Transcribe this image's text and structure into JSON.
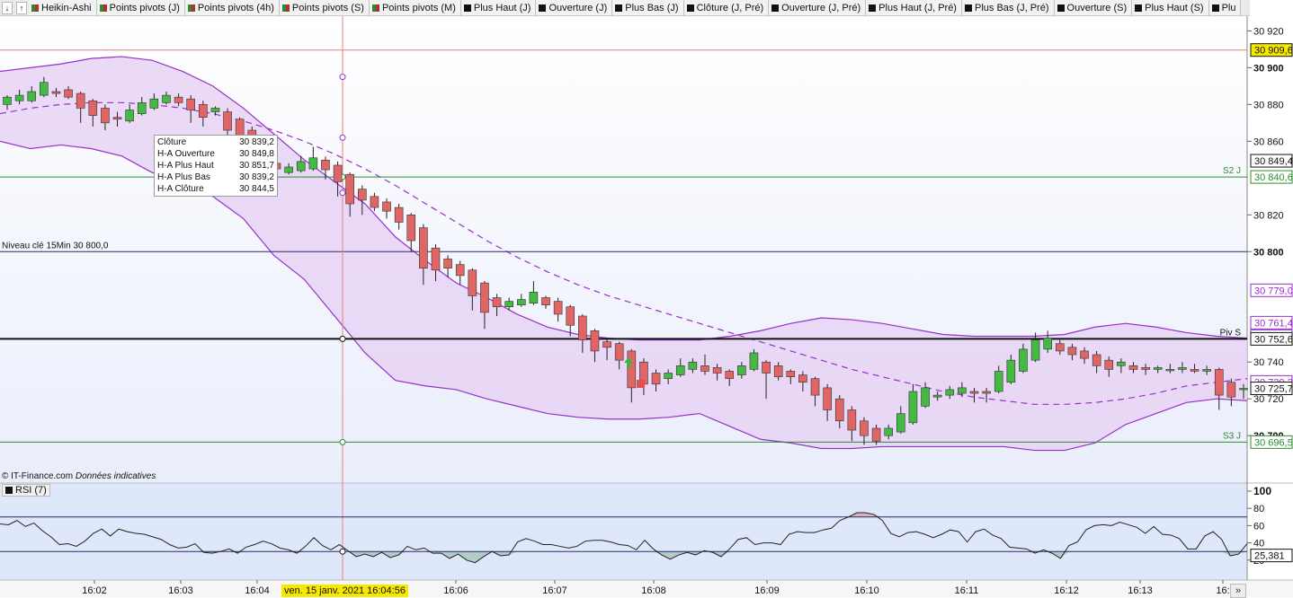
{
  "toolbar": {
    "items": [
      {
        "label": "Heikin-Ashi",
        "marker": "grn"
      },
      {
        "label": "Points pivots (J)",
        "marker": "grn"
      },
      {
        "label": "Points pivots (4h)",
        "marker": "grn"
      },
      {
        "label": "Points pivots (S)",
        "marker": "grn"
      },
      {
        "label": "Points pivots (M)",
        "marker": "grn"
      },
      {
        "label": "Plus Haut (J)",
        "marker": "blk"
      },
      {
        "label": "Ouverture (J)",
        "marker": "blk"
      },
      {
        "label": "Plus Bas (J)",
        "marker": "blk"
      },
      {
        "label": "Clôture (J, Pré)",
        "marker": "blk"
      },
      {
        "label": "Ouverture (J, Pré)",
        "marker": "blk"
      },
      {
        "label": "Plus Haut (J, Pré)",
        "marker": "blk"
      },
      {
        "label": "Plus Bas (J, Pré)",
        "marker": "blk"
      },
      {
        "label": "Ouverture (S)",
        "marker": "blk"
      },
      {
        "label": "Plus Haut (S)",
        "marker": "blk"
      },
      {
        "label": "Plu",
        "marker": "blk"
      }
    ]
  },
  "tooltip": {
    "rows": [
      {
        "label": "Clôture",
        "value": "30 839,2"
      },
      {
        "label": "H-A Ouverture",
        "value": "30 849,8"
      },
      {
        "label": "H-A Plus Haut",
        "value": "30 851,7"
      },
      {
        "label": "H-A Plus Bas",
        "value": "30 839,2"
      },
      {
        "label": "H-A Clôture",
        "value": "30 844,5"
      }
    ]
  },
  "credit": {
    "source": "© IT-Finance.com",
    "note": "Données indicatives"
  },
  "rsi_label": "RSI (7)",
  "crosshair_date": "ven. 15 janv. 2021 16:04:56",
  "scroll_glyph": "»",
  "colors": {
    "up": "#44b944",
    "down": "#e06666",
    "band": "#9a2fc9",
    "band_fill": "#e6d3f4",
    "support": "#2e8b2e",
    "pivot": "#111111",
    "key": "#2a2a6a",
    "cursor": "#e88080",
    "rsi": "#222266"
  },
  "chart_data": {
    "type": "candlestick",
    "ylim": [
      30683,
      30928
    ],
    "yticks": [
      {
        "v": 30920,
        "t": "30 920"
      },
      {
        "v": 30900,
        "t": "30 900"
      },
      {
        "v": 30880,
        "t": "30 880"
      },
      {
        "v": 30860,
        "t": "30 860"
      },
      {
        "v": 30820,
        "t": "30 820"
      },
      {
        "v": 30800,
        "t": "30 800"
      },
      {
        "v": 30740,
        "t": "30 740"
      },
      {
        "v": 30720,
        "t": "30 720"
      },
      {
        "v": 30700,
        "t": "30 700"
      }
    ],
    "xticks": [
      "16:02",
      "16:03",
      "16:04",
      "16:06",
      "16:07",
      "16:08",
      "16:09",
      "16:10",
      "16:11",
      "16:12",
      "16:13",
      "16:"
    ],
    "hlines": [
      {
        "name": "cursor-price",
        "v": 30909.6,
        "label": "",
        "tag": "30 909,6",
        "tagbg": "#f7e800",
        "color": "cursor"
      },
      {
        "name": "s2-j",
        "v": 30840.6,
        "label": "S2 J",
        "tag": "30 840,6",
        "tagbg": "#fff",
        "color": "support"
      },
      {
        "name": "key-level",
        "v": 30800,
        "label": "Niveau clé 15Min 30 800,0",
        "tag": "",
        "tagbg": "#fff",
        "color": "key"
      },
      {
        "name": "piv-s",
        "v": 30752.6,
        "label": "Piv S",
        "tag": "30 752,6",
        "tagbg": "#fff",
        "color": "pivot"
      },
      {
        "name": "s3-j",
        "v": 30696.5,
        "label": "S3 J",
        "tag": "30 696,5",
        "tagbg": "#fff",
        "color": "support"
      }
    ],
    "price_tags": [
      {
        "v": 30849.4,
        "t": "30 849,4",
        "color": "#111"
      },
      {
        "v": 30779.0,
        "t": "30 779,0",
        "color": "#9a2fc9"
      },
      {
        "v": 30761.4,
        "t": "30 761,4",
        "color": "#9a2fc9"
      },
      {
        "v": 30754.1,
        "t": "30 754,1",
        "color": "#9a2fc9"
      },
      {
        "v": 30729.2,
        "t": "30 729,2",
        "color": "#9a2fc9"
      },
      {
        "v": 30725.7,
        "t": "30 725,7",
        "color": "#111"
      }
    ],
    "candles": [
      {
        "o": 30880,
        "h": 30885,
        "l": 30877,
        "c": 30884
      },
      {
        "o": 30882,
        "h": 30888,
        "l": 30880,
        "c": 30885
      },
      {
        "o": 30882,
        "h": 30890,
        "l": 30881,
        "c": 30887
      },
      {
        "o": 30885,
        "h": 30895,
        "l": 30884,
        "c": 30892
      },
      {
        "o": 30887,
        "h": 30889,
        "l": 30884,
        "c": 30886
      },
      {
        "o": 30888,
        "h": 30890,
        "l": 30883,
        "c": 30884
      },
      {
        "o": 30886,
        "h": 30887,
        "l": 30870,
        "c": 30878
      },
      {
        "o": 30882,
        "h": 30883,
        "l": 30868,
        "c": 30874
      },
      {
        "o": 30878,
        "h": 30880,
        "l": 30866,
        "c": 30870
      },
      {
        "o": 30873,
        "h": 30876,
        "l": 30868,
        "c": 30872
      },
      {
        "o": 30871,
        "h": 30880,
        "l": 30870,
        "c": 30877
      },
      {
        "o": 30875,
        "h": 30884,
        "l": 30874,
        "c": 30881
      },
      {
        "o": 30878,
        "h": 30886,
        "l": 30877,
        "c": 30883
      },
      {
        "o": 30881,
        "h": 30887,
        "l": 30880,
        "c": 30885
      },
      {
        "o": 30884,
        "h": 30886,
        "l": 30879,
        "c": 30881
      },
      {
        "o": 30883,
        "h": 30885,
        "l": 30870,
        "c": 30877
      },
      {
        "o": 30880,
        "h": 30882,
        "l": 30868,
        "c": 30873
      },
      {
        "o": 30876,
        "h": 30879,
        "l": 30874,
        "c": 30878
      },
      {
        "o": 30876,
        "h": 30878,
        "l": 30860,
        "c": 30866
      },
      {
        "o": 30872,
        "h": 30873,
        "l": 30848,
        "c": 30860
      },
      {
        "o": 30866,
        "h": 30868,
        "l": 30845,
        "c": 30852
      },
      {
        "o": 30856,
        "h": 30858,
        "l": 30838,
        "c": 30844
      },
      {
        "o": 30848,
        "h": 30850,
        "l": 30842,
        "c": 30845
      },
      {
        "o": 30843,
        "h": 30848,
        "l": 30842,
        "c": 30846
      },
      {
        "o": 30844,
        "h": 30852,
        "l": 30843,
        "c": 30849
      },
      {
        "o": 30845,
        "h": 30857,
        "l": 30844,
        "c": 30851
      },
      {
        "o": 30849.8,
        "h": 30851.7,
        "l": 30839.2,
        "c": 30844.5
      },
      {
        "o": 30847,
        "h": 30849,
        "l": 30830,
        "c": 30838
      },
      {
        "o": 30842,
        "h": 30843,
        "l": 30819,
        "c": 30826
      },
      {
        "o": 30834,
        "h": 30836,
        "l": 30820,
        "c": 30828
      },
      {
        "o": 30830,
        "h": 30832,
        "l": 30822,
        "c": 30824
      },
      {
        "o": 30827,
        "h": 30829,
        "l": 30818,
        "c": 30822
      },
      {
        "o": 30824,
        "h": 30826,
        "l": 30812,
        "c": 30816
      },
      {
        "o": 30820,
        "h": 30821,
        "l": 30800,
        "c": 30806
      },
      {
        "o": 30813,
        "h": 30815,
        "l": 30782,
        "c": 30791
      },
      {
        "o": 30802,
        "h": 30804,
        "l": 30784,
        "c": 30790
      },
      {
        "o": 30796,
        "h": 30798,
        "l": 30786,
        "c": 30791
      },
      {
        "o": 30793,
        "h": 30795,
        "l": 30782,
        "c": 30787
      },
      {
        "o": 30790,
        "h": 30791,
        "l": 30768,
        "c": 30776
      },
      {
        "o": 30783,
        "h": 30784,
        "l": 30758,
        "c": 30767
      },
      {
        "o": 30775,
        "h": 30777,
        "l": 30765,
        "c": 30770
      },
      {
        "o": 30770,
        "h": 30775,
        "l": 30768,
        "c": 30773
      },
      {
        "o": 30771,
        "h": 30777,
        "l": 30770,
        "c": 30774
      },
      {
        "o": 30772,
        "h": 30784,
        "l": 30771,
        "c": 30778
      },
      {
        "o": 30775,
        "h": 30776,
        "l": 30769,
        "c": 30771
      },
      {
        "o": 30773,
        "h": 30775,
        "l": 30762,
        "c": 30766
      },
      {
        "o": 30770,
        "h": 30771,
        "l": 30754,
        "c": 30760
      },
      {
        "o": 30765,
        "h": 30766,
        "l": 30745,
        "c": 30752
      },
      {
        "o": 30757,
        "h": 30758,
        "l": 30740,
        "c": 30746
      },
      {
        "o": 30751,
        "h": 30753,
        "l": 30741,
        "c": 30748
      },
      {
        "o": 30750,
        "h": 30751,
        "l": 30736,
        "c": 30741
      },
      {
        "o": 30746,
        "h": 30747,
        "l": 30718,
        "c": 30726
      },
      {
        "o": 30740,
        "h": 30742,
        "l": 30722,
        "c": 30728
      },
      {
        "o": 30734,
        "h": 30736,
        "l": 30724,
        "c": 30728
      },
      {
        "o": 30731,
        "h": 30736,
        "l": 30728,
        "c": 30734
      },
      {
        "o": 30733,
        "h": 30742,
        "l": 30732,
        "c": 30738
      },
      {
        "o": 30736,
        "h": 30742,
        "l": 30734,
        "c": 30740
      },
      {
        "o": 30738,
        "h": 30744,
        "l": 30733,
        "c": 30735
      },
      {
        "o": 30737,
        "h": 30739,
        "l": 30730,
        "c": 30734
      },
      {
        "o": 30735,
        "h": 30736,
        "l": 30727,
        "c": 30731
      },
      {
        "o": 30733,
        "h": 30740,
        "l": 30731,
        "c": 30738
      },
      {
        "o": 30736,
        "h": 30747,
        "l": 30735,
        "c": 30745
      },
      {
        "o": 30740,
        "h": 30741,
        "l": 30720,
        "c": 30734
      },
      {
        "o": 30738,
        "h": 30740,
        "l": 30730,
        "c": 30732
      },
      {
        "o": 30735,
        "h": 30736,
        "l": 30728,
        "c": 30732
      },
      {
        "o": 30733,
        "h": 30735,
        "l": 30724,
        "c": 30729
      },
      {
        "o": 30731,
        "h": 30732,
        "l": 30716,
        "c": 30722
      },
      {
        "o": 30726,
        "h": 30728,
        "l": 30708,
        "c": 30714
      },
      {
        "o": 30720,
        "h": 30722,
        "l": 30704,
        "c": 30708
      },
      {
        "o": 30714,
        "h": 30716,
        "l": 30697,
        "c": 30703
      },
      {
        "o": 30708,
        "h": 30710,
        "l": 30695,
        "c": 30700
      },
      {
        "o": 30704,
        "h": 30706,
        "l": 30695,
        "c": 30697
      },
      {
        "o": 30700,
        "h": 30706,
        "l": 30698,
        "c": 30704
      },
      {
        "o": 30702,
        "h": 30716,
        "l": 30701,
        "c": 30712
      },
      {
        "o": 30707,
        "h": 30728,
        "l": 30706,
        "c": 30724
      },
      {
        "o": 30716,
        "h": 30729,
        "l": 30715,
        "c": 30726
      },
      {
        "o": 30721,
        "h": 30724,
        "l": 30719,
        "c": 30722
      },
      {
        "o": 30722,
        "h": 30727,
        "l": 30720,
        "c": 30725
      },
      {
        "o": 30723,
        "h": 30729,
        "l": 30721,
        "c": 30726
      },
      {
        "o": 30724,
        "h": 30726,
        "l": 30718,
        "c": 30723
      },
      {
        "o": 30724,
        "h": 30726,
        "l": 30718,
        "c": 30723
      },
      {
        "o": 30724,
        "h": 30738,
        "l": 30723,
        "c": 30735
      },
      {
        "o": 30729,
        "h": 30744,
        "l": 30728,
        "c": 30741
      },
      {
        "o": 30735,
        "h": 30750,
        "l": 30734,
        "c": 30747
      },
      {
        "o": 30741,
        "h": 30756,
        "l": 30740,
        "c": 30752
      },
      {
        "o": 30747,
        "h": 30757,
        "l": 30745,
        "c": 30753
      },
      {
        "o": 30750,
        "h": 30752,
        "l": 30744,
        "c": 30746
      },
      {
        "o": 30748,
        "h": 30750,
        "l": 30741,
        "c": 30744
      },
      {
        "o": 30746,
        "h": 30748,
        "l": 30739,
        "c": 30742
      },
      {
        "o": 30744,
        "h": 30746,
        "l": 30734,
        "c": 30738
      },
      {
        "o": 30741,
        "h": 30743,
        "l": 30732,
        "c": 30736
      },
      {
        "o": 30738,
        "h": 30742,
        "l": 30734,
        "c": 30740
      },
      {
        "o": 30738,
        "h": 30740,
        "l": 30734,
        "c": 30736
      },
      {
        "o": 30737,
        "h": 30739,
        "l": 30733,
        "c": 30736
      },
      {
        "o": 30736,
        "h": 30738,
        "l": 30734,
        "c": 30737
      },
      {
        "o": 30736,
        "h": 30739,
        "l": 30734,
        "c": 30736
      },
      {
        "o": 30736,
        "h": 30740,
        "l": 30734,
        "c": 30737
      },
      {
        "o": 30736,
        "h": 30739,
        "l": 30734,
        "c": 30735
      },
      {
        "o": 30735,
        "h": 30738,
        "l": 30733,
        "c": 30736
      },
      {
        "o": 30736,
        "h": 30737,
        "l": 30714,
        "c": 30722
      },
      {
        "o": 30729,
        "h": 30731,
        "l": 30716,
        "c": 30721
      },
      {
        "o": 30725,
        "h": 30728,
        "l": 30720,
        "c": 30725.7
      }
    ],
    "bb_mid": [
      30875,
      30878,
      30880,
      30881,
      30881,
      30880,
      30878,
      30875,
      30871,
      30866,
      30860,
      30853,
      30845,
      30836,
      30826,
      30816,
      30806,
      30797,
      30789,
      30782,
      30776,
      30771,
      30766,
      30761,
      30756,
      30751,
      30746,
      30741,
      30736,
      30732,
      30728,
      30724,
      30721,
      30719,
      30717,
      30717,
      30718,
      30720,
      30723,
      30727,
      30729,
      30731
    ],
    "bb_upper": [
      30898,
      30900,
      30902,
      30905,
      30906,
      30904,
      30898,
      30890,
      30878,
      30864,
      30850,
      30838,
      30826,
      30808,
      30795,
      30783,
      30775,
      30766,
      30759,
      30755,
      30753,
      30752,
      30752,
      30752,
      30754,
      30757,
      30761,
      30764,
      30763,
      30761,
      30758,
      30755,
      30754,
      30754,
      30754,
      30755,
      30759,
      30761,
      30759,
      30756,
      30754,
      30753
    ],
    "bb_lower": [
      30860,
      30856,
      30858,
      30856,
      30852,
      30843,
      30838,
      30830,
      30818,
      30798,
      30785,
      30765,
      30745,
      30730,
      30727,
      30725,
      30720,
      30716,
      30712,
      30710,
      30709,
      30709,
      30710,
      30712,
      30705,
      30698,
      30696,
      30693,
      30693,
      30694,
      30694,
      30694,
      30694,
      30694,
      30692,
      30692,
      30696,
      30706,
      30712,
      30718,
      30720,
      30719
    ],
    "rsi": {
      "name": "RSI (7)",
      "levels": [
        70,
        30
      ],
      "ylim": [
        0,
        100
      ],
      "ticks": [
        {
          "v": 100,
          "t": "100"
        },
        {
          "v": 80,
          "t": "80"
        },
        {
          "v": 60,
          "t": "60"
        },
        {
          "v": 40,
          "t": "40"
        },
        {
          "v": 20,
          "t": "20"
        }
      ],
      "last_tag": "25,381",
      "values": [
        62,
        61,
        66,
        59,
        63,
        54,
        47,
        38,
        39,
        36,
        42,
        51,
        56,
        48,
        56,
        53,
        51,
        50,
        47,
        44,
        38,
        34,
        35,
        39,
        29,
        28,
        30,
        33,
        28,
        35,
        38,
        42,
        39,
        34,
        32,
        28,
        36,
        46,
        37,
        32,
        38,
        31,
        24,
        27,
        24,
        29,
        23,
        26,
        36,
        32,
        34,
        28,
        28,
        22,
        27,
        20,
        17,
        24,
        30,
        25,
        26,
        41,
        45,
        42,
        38,
        38,
        36,
        34,
        36,
        42,
        43,
        43,
        41,
        38,
        37,
        32,
        43,
        33,
        26,
        21,
        26,
        29,
        26,
        31,
        29,
        24,
        33,
        44,
        46,
        38,
        40,
        40,
        38,
        50,
        53,
        52,
        52,
        55,
        57,
        66,
        70,
        75,
        75,
        73,
        66,
        51,
        47,
        52,
        53,
        50,
        46,
        50,
        55,
        53,
        41,
        53,
        56,
        49,
        45,
        35,
        34,
        33,
        28,
        32,
        28,
        22,
        37,
        41,
        55,
        60,
        61,
        60,
        64,
        61,
        58,
        51,
        59,
        50,
        49,
        45,
        33,
        33,
        48,
        53,
        44,
        25,
        27,
        39
      ]
    }
  }
}
